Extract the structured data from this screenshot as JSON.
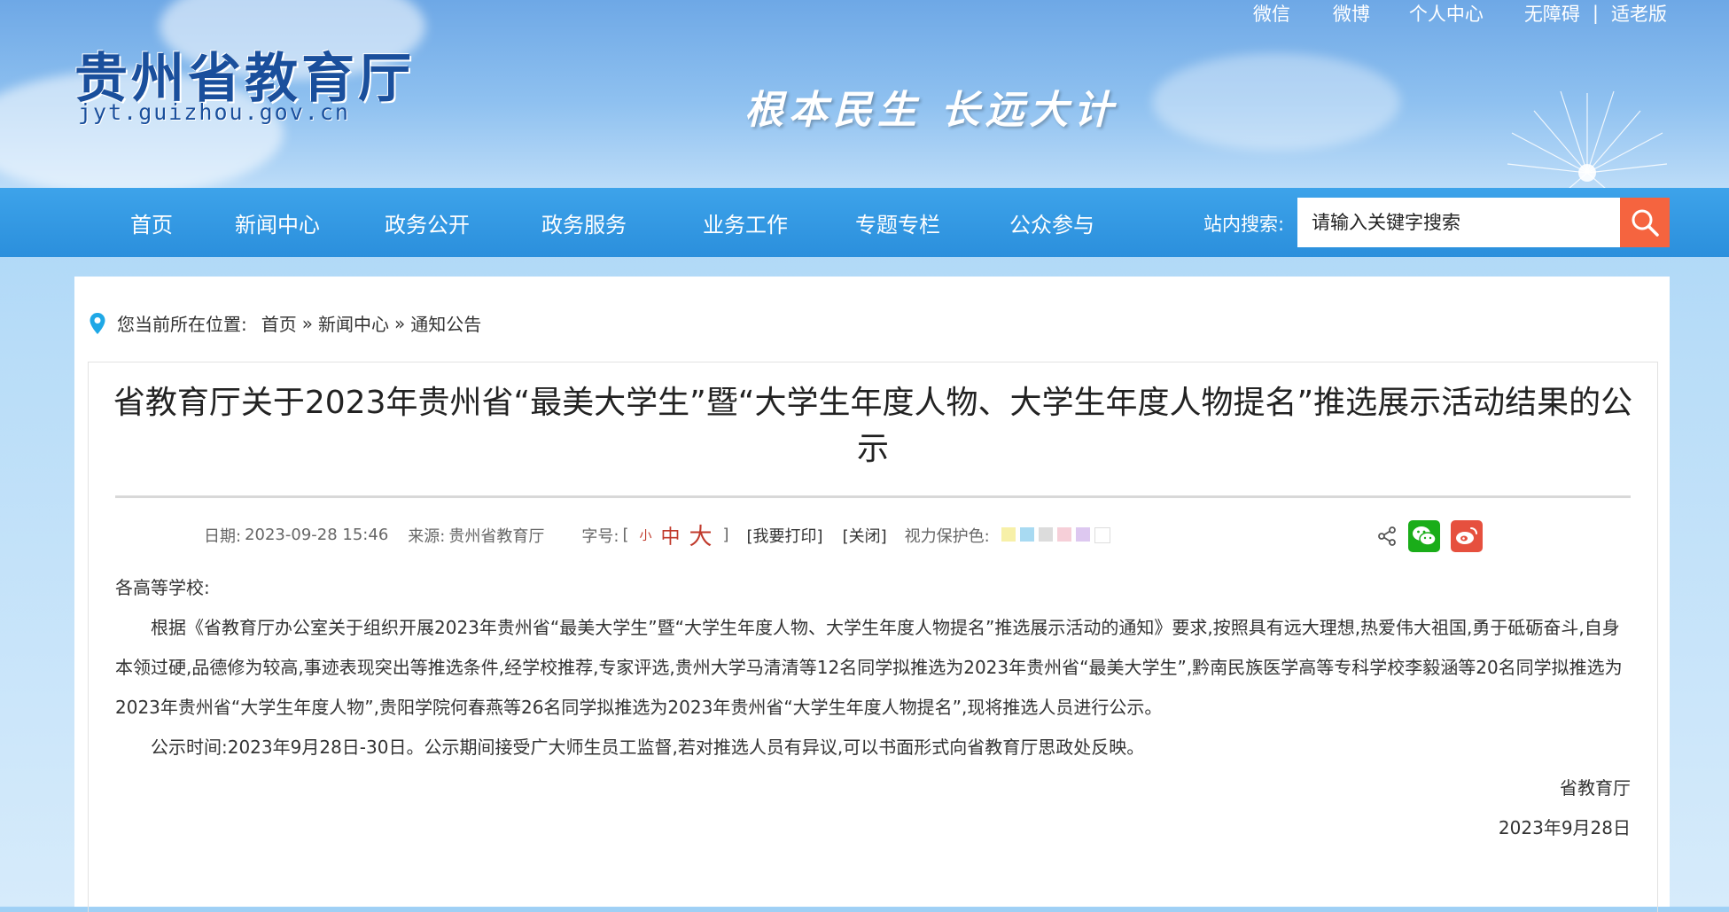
{
  "header": {
    "site_title": "贵州省教育厅",
    "site_url": "jyt.guizhou.gov.cn",
    "slogan": "根本民生 长远大计",
    "top_links": [
      "微信",
      "微博",
      "个人中心",
      "无障碍",
      "适老版"
    ],
    "separator": "|"
  },
  "nav": {
    "items": [
      "首页",
      "新闻中心",
      "政务公开",
      "政务服务",
      "业务工作",
      "专题专栏",
      "公众参与"
    ],
    "search_label": "站内搜索:",
    "search_placeholder": "请输入关键字搜索"
  },
  "breadcrumb": {
    "prefix": "您当前所在位置:",
    "items": [
      "首页",
      "新闻中心",
      "通知公告"
    ],
    "sep": "»"
  },
  "article": {
    "title": "省教育厅关于2023年贵州省“最美大学生”暨“大学生年度人物、大学生年度人物提名”推选展示活动结果的公示",
    "date_label": "日期:",
    "date": "2023-09-28 15:46",
    "source_label": "来源:",
    "source": "贵州省教育厅",
    "fontsize_label": "字号:",
    "bracket_open": "[",
    "bracket_close": "]",
    "size_small": "小",
    "size_medium": "中",
    "size_large": "大",
    "print": "[我要打印]",
    "close": "[关闭]",
    "eye_label": "视力保护色:",
    "eye_colors": [
      "#f7f0a8",
      "#a8daf2",
      "#dcdcdc",
      "#f6cfd8",
      "#ddc8f0",
      "#ffffff"
    ],
    "greeting": "各高等学校:",
    "paragraphs": [
      "根据《省教育厅办公室关于组织开展2023年贵州省“最美大学生”暨“大学生年度人物、大学生年度人物提名”推选展示活动的通知》要求,按照具有远大理想,热爱伟大祖国,勇于砥砺奋斗,自身本领过硬,品德修为较高,事迹表现突出等推选条件,经学校推荐,专家评选,贵州大学马清清等12名同学拟推选为2023年贵州省“最美大学生”,黔南民族医学高等专科学校李毅涵等20名同学拟推选为2023年贵州省“大学生年度人物”,贵阳学院何春燕等26名同学拟推选为2023年贵州省“大学生年度人物提名”,现将推选人员进行公示。",
      "公示时间:2023年9月28日-30日。公示期间接受广大师生员工监督,若对推选人员有异议,可以书面形式向省教育厅思政处反映。"
    ],
    "signature": "省教育厅",
    "sign_date": "2023年9月28日"
  },
  "colors": {
    "nav_bg": "#2b8fdc",
    "search_button": "#f5643f",
    "wechat": "#1aad19",
    "weibo": "#e6503e"
  }
}
